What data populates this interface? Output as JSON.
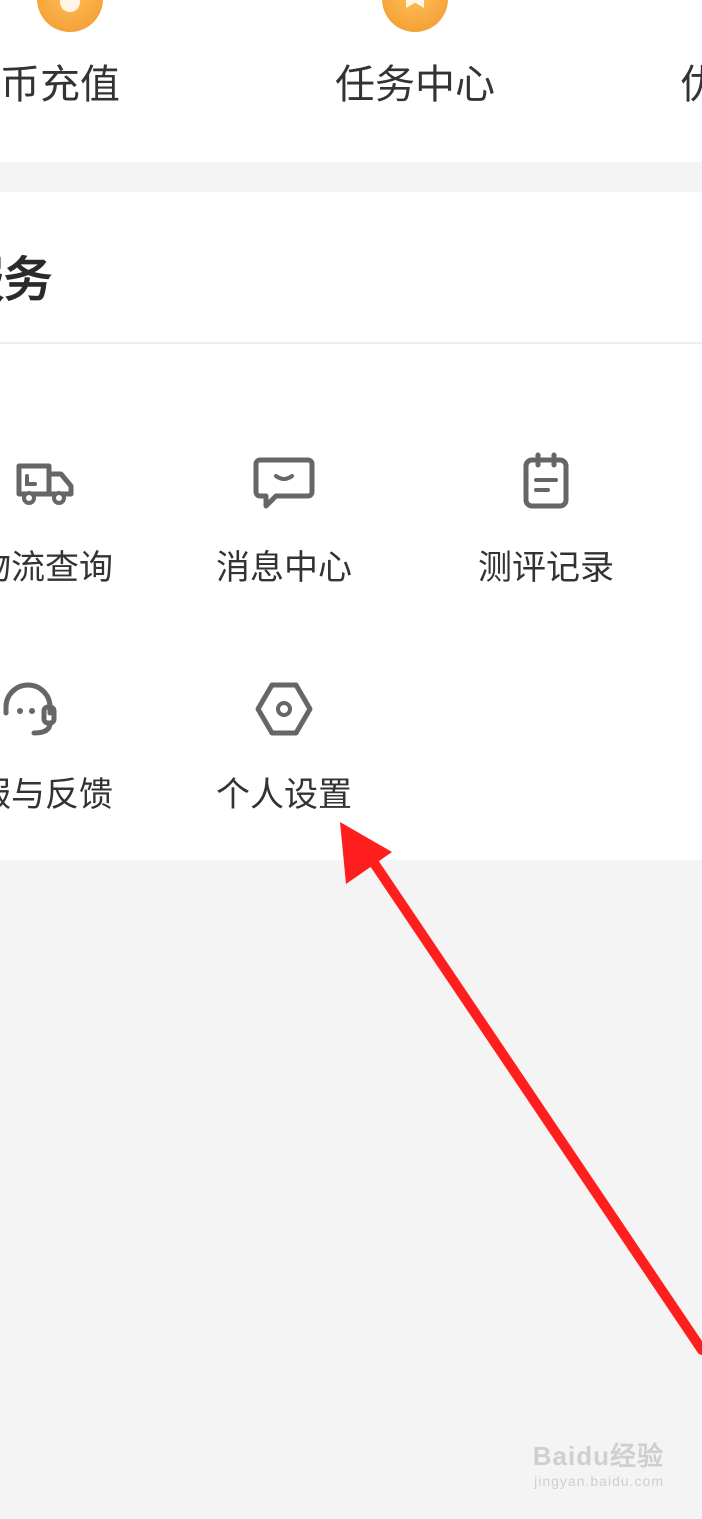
{
  "top_actions": [
    {
      "label": "学币充值",
      "icon": "coin-icon"
    },
    {
      "label": "任务中心",
      "icon": "bookmark-icon"
    },
    {
      "label": "优",
      "icon": "coupon-icon"
    }
  ],
  "services": {
    "title": "服务",
    "items": [
      {
        "label": "物流查询",
        "icon": "truck-icon"
      },
      {
        "label": "消息中心",
        "icon": "message-icon"
      },
      {
        "label": "测评记录",
        "icon": "clipboard-icon"
      },
      {
        "label": "客服与反馈",
        "icon": "headset-icon"
      },
      {
        "label": "个人设置",
        "icon": "settings-hex-icon"
      }
    ]
  },
  "annotation": {
    "color": "#ff1e1e"
  },
  "watermark": {
    "logo": "Baidu经验",
    "url": "jingyan.baidu.com"
  },
  "colors": {
    "accent": "#f5a43a",
    "background": "#f4f4f4",
    "icon_gray": "#666666"
  }
}
